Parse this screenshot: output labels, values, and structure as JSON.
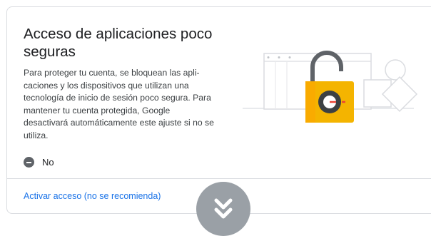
{
  "card": {
    "title": "Acceso de aplicaciones poco seguras",
    "description": "Para proteger tu cuenta, se bloquean las apli-caciones y los dispositivos que utilizan una tecnología de inicio de sesión poco segura. Para mantener tu cuenta protegida, Google desactivará automáticamente este ajuste si no se utiliza.",
    "status_label": "No",
    "status_icon": "minus-circle-icon",
    "action_label": "Activar acceso (no se recomienda)"
  },
  "illustration": {
    "icon": "padlock-illustration",
    "lock_color": "#f4b400"
  },
  "scroll_button": {
    "icon": "double-chevron-down-icon"
  },
  "colors": {
    "accent": "#1a73e8",
    "border": "#dadce0",
    "text": "#202124",
    "scroll_button": "#9aa0a6"
  }
}
